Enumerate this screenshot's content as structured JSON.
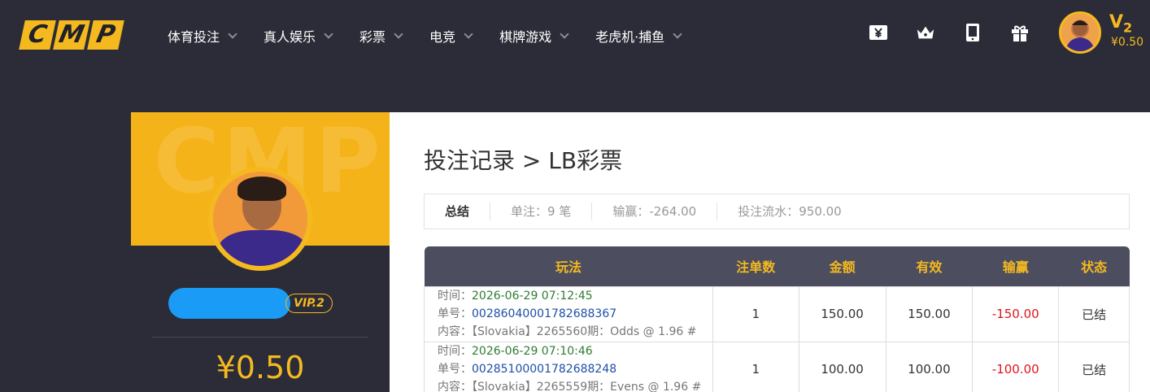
{
  "logo": [
    "C",
    "M",
    "P"
  ],
  "nav": [
    {
      "label": "体育投注"
    },
    {
      "label": "真人娱乐"
    },
    {
      "label": "彩票"
    },
    {
      "label": "电竞"
    },
    {
      "label": "棋牌游戏"
    },
    {
      "label": "老虎机·捕鱼"
    }
  ],
  "header_icons": [
    "yen-ticket-icon",
    "crown-icon",
    "tablet-icon",
    "gift-icon"
  ],
  "user": {
    "vip_level": "V",
    "vip_num": "2",
    "balance": "¥0.50",
    "vip_badge": "VIP.2",
    "side_balance": "¥0.50"
  },
  "side_watermark": "CMP",
  "page": {
    "title": "投注记录 > LB彩票"
  },
  "summary": {
    "label": "总结",
    "bets": "单注：9 笔",
    "winloss": "输赢：-264.00",
    "turnover": "投注流水：950.00"
  },
  "table": {
    "headers": [
      "玩法",
      "注单数",
      "金额",
      "有效",
      "输赢",
      "状态"
    ],
    "rows": [
      {
        "time_label": "时间：",
        "time": "2026-06-29 07:12:45",
        "order_label": "单号：",
        "order": "00286040001782688367",
        "content_label": "内容：",
        "content": "【Slovakia】2265560期：Odds @ 1.96 #",
        "count": "1",
        "amount": "150.00",
        "valid": "150.00",
        "winloss": "-150.00",
        "status": "已结"
      },
      {
        "time_label": "时间：",
        "time": "2026-06-29 07:10:46",
        "order_label": "单号：",
        "order": "00285100001782688248",
        "content_label": "内容：",
        "content": "【Slovakia】2265559期：Evens @ 1.96 #",
        "count": "1",
        "amount": "100.00",
        "valid": "100.00",
        "winloss": "-100.00",
        "status": "已结"
      }
    ]
  },
  "colors": {
    "accent": "#f5b920",
    "background": "#2b2c37",
    "table_header": "#4c4d5f",
    "negative": "#e0141c",
    "time": "#2e7d32",
    "order": "#1e4fa8"
  }
}
